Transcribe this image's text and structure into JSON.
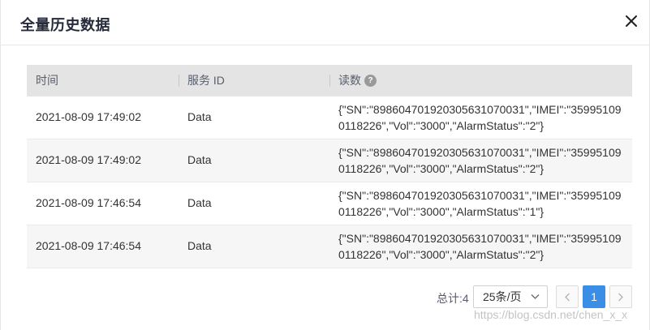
{
  "dialog": {
    "title": "全量历史数据"
  },
  "table": {
    "columns": [
      "时间",
      "服务 ID",
      "读数"
    ],
    "help_glyph": "?",
    "rows": [
      {
        "time": "2021-08-09 17:49:02",
        "service": "Data",
        "reading": "{\"SN\":\"89860470192030563107003​1\",\"IMEI\":\"359951090118226\",\"Vol\":\"3000\",\"AlarmStatus\":\"2\"}"
      },
      {
        "time": "2021-08-09 17:49:02",
        "service": "Data",
        "reading": "{\"SN\":\"89860470192030563107003​1\",\"IMEI\":\"359951090118226\",\"Vol\":\"3000\",\"AlarmStatus\":\"2\"}"
      },
      {
        "time": "2021-08-09 17:46:54",
        "service": "Data",
        "reading": "{\"SN\":\"89860470192030563107003​1\",\"IMEI\":\"359951090118226\",\"Vol\":\"3000\",\"AlarmStatus\":\"1\"}"
      },
      {
        "time": "2021-08-09 17:46:54",
        "service": "Data",
        "reading": "{\"SN\":\"89860470192030563107003​1\",\"IMEI\":\"359951090118226\",\"Vol\":\"3000\",\"AlarmStatus\":\"2\"}"
      }
    ]
  },
  "pagination": {
    "total_label": "总计:4",
    "page_size": "25条/页",
    "current_page": "1"
  },
  "watermark": "https://blog.csdn.net/chen_x_x",
  "colors": {
    "accent": "#3a8ee6",
    "header_bg": "#e4e4e4",
    "alt_row_bg": "#f6f6f6"
  }
}
